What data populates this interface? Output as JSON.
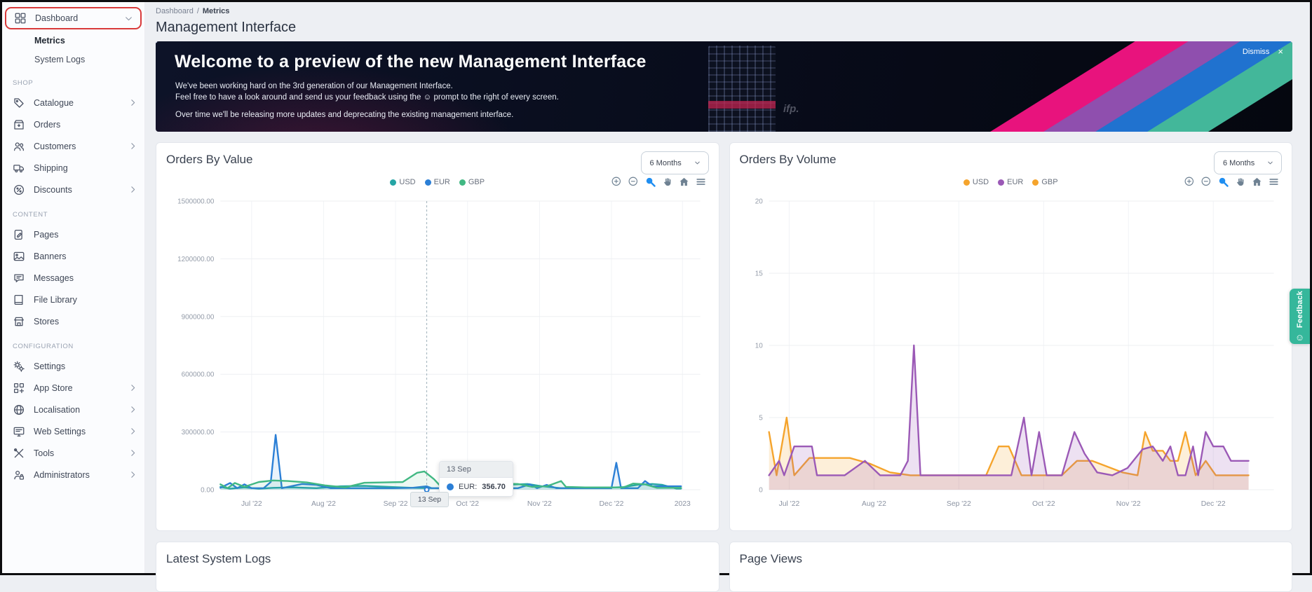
{
  "sidebar": {
    "dashboard": {
      "label": "Dashboard",
      "icon": "dashboard"
    },
    "sub_items": [
      {
        "label": "Metrics",
        "active": true
      },
      {
        "label": "System Logs",
        "active": false
      }
    ],
    "sections": [
      {
        "header": "SHOP",
        "items": [
          {
            "label": "Catalogue",
            "icon": "tag",
            "chevron": true
          },
          {
            "label": "Orders",
            "icon": "box",
            "chevron": false
          },
          {
            "label": "Customers",
            "icon": "users",
            "chevron": true
          },
          {
            "label": "Shipping",
            "icon": "truck",
            "chevron": false
          },
          {
            "label": "Discounts",
            "icon": "percent",
            "chevron": true
          }
        ]
      },
      {
        "header": "CONTENT",
        "items": [
          {
            "label": "Pages",
            "icon": "page",
            "chevron": false
          },
          {
            "label": "Banners",
            "icon": "image",
            "chevron": false
          },
          {
            "label": "Messages",
            "icon": "chat",
            "chevron": false
          },
          {
            "label": "File Library",
            "icon": "book",
            "chevron": false
          },
          {
            "label": "Stores",
            "icon": "store",
            "chevron": false
          }
        ]
      },
      {
        "header": "CONFIGURATION",
        "items": [
          {
            "label": "Settings",
            "icon": "gears",
            "chevron": false
          },
          {
            "label": "App Store",
            "icon": "app",
            "chevron": true
          },
          {
            "label": "Localisation",
            "icon": "globe",
            "chevron": true
          },
          {
            "label": "Web Settings",
            "icon": "monitor",
            "chevron": true
          },
          {
            "label": "Tools",
            "icon": "tools",
            "chevron": true
          },
          {
            "label": "Administrators",
            "icon": "admin",
            "chevron": true
          }
        ]
      }
    ]
  },
  "header": {
    "breadcrumb_parent": "Dashboard",
    "breadcrumb_sep": "/",
    "breadcrumb_current": "Metrics",
    "title": "Management Interface"
  },
  "banner": {
    "heading": "Welcome to a preview of the new Management Interface",
    "line1": "We've been working hard on the 3rd generation of our Management Interface.",
    "line2": "Feel free to have a look around and send us your feedback using the ☺ prompt to the right of every screen.",
    "line3": "Over time we'll be releasing more updates and deprecating the existing management interface.",
    "dismiss_label": "Dismiss",
    "close_symbol": "×",
    "watermark": "ifp.",
    "stripe_colors": [
      "#e8137d",
      "#8f4fae",
      "#2072cf",
      "#43b79a"
    ]
  },
  "charts": [
    {
      "title": "Orders By Value",
      "range_selector": "6 Months"
    },
    {
      "title": "Orders By Volume",
      "range_selector": "6 Months"
    }
  ],
  "tooltip": {
    "date": "13 Sep",
    "series_label": "EUR:",
    "value": "356.70",
    "xaxis_label": "13 Sep",
    "marker_color": "#2b7fd6"
  },
  "chart_data": [
    {
      "type": "line",
      "title": "Orders By Value",
      "ylabel": "",
      "xlabel": "",
      "ylim": [
        0,
        1500000
      ],
      "grid": true,
      "legend_position": "top",
      "ytick_labels": [
        "0.00",
        "300000.00",
        "600000.00",
        "900000.00",
        "1200000.00",
        "1500000.00"
      ],
      "yticks": [
        0,
        300000,
        600000,
        900000,
        1200000,
        1500000
      ],
      "xticks": [
        {
          "label": "Jul '22",
          "f": 0.065
        },
        {
          "label": "Aug '22",
          "f": 0.215
        },
        {
          "label": "Sep '22",
          "f": 0.365
        },
        {
          "label": "Oct '22",
          "f": 0.515
        },
        {
          "label": "Nov '22",
          "f": 0.665
        },
        {
          "label": "Dec '22",
          "f": 0.815
        },
        {
          "label": "2023",
          "f": 0.963
        }
      ],
      "crosshair_f": 0.43,
      "series": [
        {
          "name": "USD",
          "color": "#25a5a5",
          "points": [
            [
              0,
              15000
            ],
            [
              0.02,
              5000
            ],
            [
              0.05,
              12000
            ],
            [
              0.08,
              5000
            ],
            [
              0.11,
              10000
            ],
            [
              0.15,
              12000
            ],
            [
              0.2,
              8000
            ],
            [
              0.25,
              18000
            ],
            [
              0.3,
              20000
            ],
            [
              0.35,
              15000
            ],
            [
              0.4,
              10000
            ],
            [
              0.45,
              8000
            ],
            [
              0.5,
              10000
            ],
            [
              0.55,
              14000
            ],
            [
              0.6,
              26000
            ],
            [
              0.64,
              30000
            ],
            [
              0.67,
              18000
            ],
            [
              0.71,
              8000
            ],
            [
              0.75,
              8000
            ],
            [
              0.8,
              10000
            ],
            [
              0.84,
              14000
            ],
            [
              0.87,
              26000
            ],
            [
              0.9,
              30000
            ],
            [
              0.92,
              26000
            ],
            [
              0.95,
              6000
            ],
            [
              0.96,
              6000
            ]
          ]
        },
        {
          "name": "EUR",
          "color": "#2b7fd6",
          "points": [
            [
              0,
              10000
            ],
            [
              0.02,
              35000
            ],
            [
              0.035,
              8000
            ],
            [
              0.05,
              28000
            ],
            [
              0.065,
              8000
            ],
            [
              0.09,
              8000
            ],
            [
              0.105,
              40000
            ],
            [
              0.115,
              285000
            ],
            [
              0.128,
              8000
            ],
            [
              0.17,
              30000
            ],
            [
              0.2,
              25000
            ],
            [
              0.23,
              8000
            ],
            [
              0.3,
              8000
            ],
            [
              0.36,
              8000
            ],
            [
              0.4,
              10000
            ],
            [
              0.43,
              18000
            ],
            [
              0.44,
              8000
            ],
            [
              0.5,
              8000
            ],
            [
              0.54,
              18000
            ],
            [
              0.56,
              8000
            ],
            [
              0.62,
              8000
            ],
            [
              0.645,
              28000
            ],
            [
              0.66,
              8000
            ],
            [
              0.68,
              25000
            ],
            [
              0.7,
              8000
            ],
            [
              0.76,
              8000
            ],
            [
              0.815,
              8000
            ],
            [
              0.825,
              140000
            ],
            [
              0.835,
              8000
            ],
            [
              0.87,
              8000
            ],
            [
              0.885,
              45000
            ],
            [
              0.9,
              18000
            ],
            [
              0.93,
              18000
            ],
            [
              0.96,
              18000
            ]
          ]
        },
        {
          "name": "GBP",
          "color": "#41b883",
          "points": [
            [
              0,
              28000
            ],
            [
              0.015,
              8000
            ],
            [
              0.03,
              35000
            ],
            [
              0.05,
              15000
            ],
            [
              0.08,
              40000
            ],
            [
              0.11,
              48000
            ],
            [
              0.14,
              45000
            ],
            [
              0.18,
              38000
            ],
            [
              0.22,
              22000
            ],
            [
              0.26,
              12000
            ],
            [
              0.3,
              36000
            ],
            [
              0.34,
              38000
            ],
            [
              0.38,
              40000
            ],
            [
              0.41,
              88000
            ],
            [
              0.425,
              95000
            ],
            [
              0.445,
              55000
            ],
            [
              0.46,
              15000
            ],
            [
              0.5,
              12000
            ],
            [
              0.54,
              25000
            ],
            [
              0.58,
              32000
            ],
            [
              0.62,
              30000
            ],
            [
              0.65,
              15000
            ],
            [
              0.68,
              18000
            ],
            [
              0.71,
              45000
            ],
            [
              0.72,
              15000
            ],
            [
              0.76,
              12000
            ],
            [
              0.8,
              12000
            ],
            [
              0.84,
              12000
            ],
            [
              0.86,
              32000
            ],
            [
              0.885,
              28000
            ],
            [
              0.91,
              10000
            ],
            [
              0.96,
              10000
            ]
          ]
        }
      ],
      "tooltip_point": {
        "x_label": "13 Sep",
        "series": "EUR",
        "value": 356.7
      }
    },
    {
      "type": "area",
      "title": "Orders By Volume",
      "ylabel": "",
      "xlabel": "",
      "ylim": [
        0,
        20
      ],
      "grid": true,
      "legend_position": "top",
      "ytick_labels": [
        "0",
        "5",
        "10",
        "15",
        "20"
      ],
      "yticks": [
        0,
        5,
        10,
        15,
        20
      ],
      "xticks": [
        {
          "label": "Jul '22",
          "f": 0.04
        },
        {
          "label": "Aug '22",
          "f": 0.208
        },
        {
          "label": "Sep '22",
          "f": 0.376
        },
        {
          "label": "Oct '22",
          "f": 0.544
        },
        {
          "label": "Nov '22",
          "f": 0.712
        },
        {
          "label": "Dec '22",
          "f": 0.88
        }
      ],
      "series": [
        {
          "name": "USD",
          "color": "#f5a42c",
          "points": [
            [
              0,
              4
            ],
            [
              0.015,
              1
            ],
            [
              0.035,
              5
            ],
            [
              0.05,
              1
            ],
            [
              0.08,
              2.2
            ],
            [
              0.12,
              2.2
            ],
            [
              0.16,
              2.2
            ],
            [
              0.2,
              1.8
            ],
            [
              0.24,
              1.2
            ],
            [
              0.28,
              1
            ],
            [
              0.34,
              1
            ],
            [
              0.4,
              1
            ],
            [
              0.43,
              1
            ],
            [
              0.455,
              3
            ],
            [
              0.475,
              3
            ],
            [
              0.5,
              1
            ],
            [
              0.54,
              1
            ],
            [
              0.58,
              1
            ],
            [
              0.61,
              2
            ],
            [
              0.64,
              2
            ],
            [
              0.67,
              1.6
            ],
            [
              0.7,
              1.2
            ],
            [
              0.73,
              1
            ],
            [
              0.745,
              4
            ],
            [
              0.76,
              2.7
            ],
            [
              0.78,
              2.7
            ],
            [
              0.795,
              2
            ],
            [
              0.81,
              2
            ],
            [
              0.825,
              4
            ],
            [
              0.845,
              1
            ],
            [
              0.865,
              2
            ],
            [
              0.885,
              1
            ],
            [
              0.95,
              1
            ]
          ]
        },
        {
          "name": "EUR",
          "color": "#9b59b6",
          "points": [
            [
              0,
              1
            ],
            [
              0.02,
              2
            ],
            [
              0.03,
              1
            ],
            [
              0.05,
              3
            ],
            [
              0.085,
              3
            ],
            [
              0.095,
              1
            ],
            [
              0.15,
              1
            ],
            [
              0.19,
              2
            ],
            [
              0.22,
              1
            ],
            [
              0.26,
              1
            ],
            [
              0.275,
              2
            ],
            [
              0.287,
              10
            ],
            [
              0.3,
              1
            ],
            [
              0.36,
              1
            ],
            [
              0.42,
              1
            ],
            [
              0.48,
              1
            ],
            [
              0.505,
              5
            ],
            [
              0.52,
              1
            ],
            [
              0.535,
              4
            ],
            [
              0.55,
              1
            ],
            [
              0.58,
              1
            ],
            [
              0.605,
              4
            ],
            [
              0.625,
              2.5
            ],
            [
              0.65,
              1.2
            ],
            [
              0.68,
              1
            ],
            [
              0.71,
              1.5
            ],
            [
              0.74,
              2.8
            ],
            [
              0.76,
              3
            ],
            [
              0.78,
              2
            ],
            [
              0.795,
              3
            ],
            [
              0.81,
              1
            ],
            [
              0.825,
              1
            ],
            [
              0.84,
              3
            ],
            [
              0.85,
              1
            ],
            [
              0.865,
              4
            ],
            [
              0.88,
              3
            ],
            [
              0.9,
              3
            ],
            [
              0.915,
              2
            ],
            [
              0.95,
              2
            ]
          ]
        },
        {
          "name": "GBP",
          "color": "#f5a42c",
          "points": []
        }
      ]
    }
  ],
  "bottom_panels": [
    {
      "title": "Latest System Logs"
    },
    {
      "title": "Page Views"
    }
  ],
  "feedback_tab": {
    "label": "Feedback",
    "smiley": "☺",
    "color": "#35b79b"
  }
}
